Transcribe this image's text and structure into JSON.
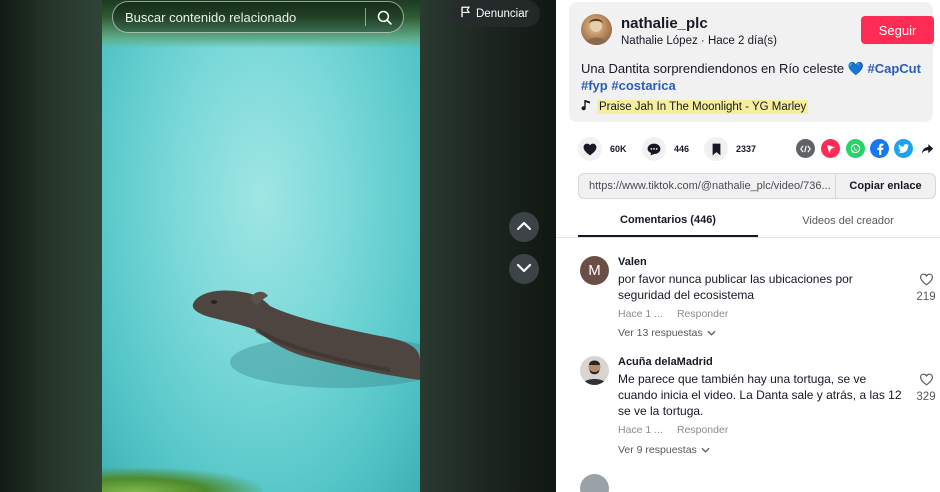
{
  "video": {
    "search_placeholder": "Buscar contenido relacionado",
    "report_label": "Denunciar"
  },
  "post": {
    "username": "nathalie_plc",
    "author_name": "Nathalie López",
    "separator": " · ",
    "time_ago": "Hace 2 día(s)",
    "follow_label": "Seguir",
    "caption_text": "Una Dantita sorprendiendonos en Río celeste",
    "caption_emoji": "💙",
    "hashtags": [
      "#CapCut",
      "#fyp",
      "#costarica"
    ],
    "music": "Praise Jah In The Moonlight - YG Marley"
  },
  "stats": {
    "likes": "60K",
    "comments": "446",
    "saves": "2337"
  },
  "share_icons": [
    {
      "name": "embed-icon",
      "color": "#5f6368"
    },
    {
      "name": "send-to-friends-icon",
      "color": "#fe2c55"
    },
    {
      "name": "whatsapp-icon",
      "color": "#25d366"
    },
    {
      "name": "facebook-icon",
      "color": "#1877f2"
    },
    {
      "name": "twitter-icon",
      "color": "#1da1f2"
    },
    {
      "name": "share-arrow-icon",
      "color": "#161823"
    }
  ],
  "link": {
    "url": "https://www.tiktok.com/@nathalie_plc/video/736...",
    "copy_label": "Copiar enlace"
  },
  "tabs": {
    "comments": "Comentarios (446)",
    "creator_videos": "Videos del creador"
  },
  "comments": [
    {
      "avatar_letter": "M",
      "author": "Valen",
      "text": "por favor nunca publicar las ubicaciones por seguridad del ecosistema",
      "time": "Hace 1 ...",
      "reply_label": "Responder",
      "view_replies": "Ver 13 respuestas",
      "likes": "219"
    },
    {
      "avatar_letter": "",
      "author": "Acuña delaMadrid",
      "text": "Me parece que también hay una tortuga, se ve cuando inicia el video. La Danta sale y atrás, a las 12 se ve la tortuga.",
      "time": "Hace 1 ...",
      "reply_label": "Responder",
      "view_replies": "Ver 9 respuestas",
      "likes": "329"
    }
  ],
  "colors": {
    "follow": "#fe2c55",
    "hashtag": "#2b5db9",
    "music_highlight": "#f5ee9c"
  }
}
